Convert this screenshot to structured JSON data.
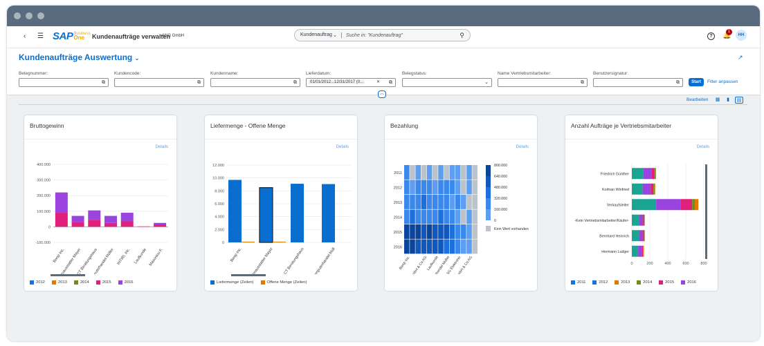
{
  "shell": {
    "app_title": "Kundenaufträge verwalten",
    "company": "ANG GmbH",
    "search_scope": "Kundenauftrag",
    "search_placeholder": "Suche in: \"Kundenauftrag\"",
    "notification_count": "1",
    "avatar_initials": "HH",
    "logo_sap": "SAP",
    "logo_business": "Business",
    "logo_one": "One"
  },
  "header": {
    "page_title": "Kundenaufträge Auswertung",
    "filters": [
      {
        "label": "Belegnummer:",
        "value": ""
      },
      {
        "label": "Kundencode:",
        "value": ""
      },
      {
        "label": "Kundenname:",
        "value": ""
      },
      {
        "label": "Lieferdatum:",
        "value": "01/01/2012...12/31/2017 (0..."
      },
      {
        "label": "Belegstatus:",
        "value": ""
      },
      {
        "label": "Name Vertriebsmitarbeiter:",
        "value": ""
      },
      {
        "label": "Benutzersignatur:",
        "value": ""
      }
    ],
    "start_label": "Start",
    "filter_adjust_label": "Filter anpassen"
  },
  "toolbar": {
    "edit_label": "Bearbeiten"
  },
  "colors": {
    "accent": "#0a6ed1",
    "y2012": "#1173e6",
    "y2013": "#e07a00",
    "y2014": "#6c8e1d",
    "y2015": "#e0207a",
    "y2016": "#9b43de",
    "y2017": "#1aa592"
  },
  "cards": {
    "gross_profit": {
      "title": "Bruttogewinn",
      "details": "Details",
      "chart_data": {
        "type": "bar",
        "stacked": true,
        "categories": [
          "Bwsp Inc.",
          "Büroausstatter Mayer",
          "CT Beratungshaus",
          "Computerhandel Müller",
          "INTIRI, Inc.",
          "Laufkunde",
          "Maxoniou F."
        ],
        "yticks": [
          "400.000",
          "300.000",
          "200.000",
          "100.000",
          "0",
          "-100.000"
        ],
        "ylim": [
          -100000,
          400000
        ],
        "series": [
          {
            "name": "2012",
            "values": [
              0,
              0,
              0,
              0,
              0,
              0,
              0
            ]
          },
          {
            "name": "2013",
            "values": [
              0,
              0,
              0,
              0,
              0,
              0,
              0
            ]
          },
          {
            "name": "2014",
            "values": [
              0,
              0,
              0,
              0,
              0,
              0,
              0
            ]
          },
          {
            "name": "2015",
            "values": [
              90000,
              30000,
              45000,
              25000,
              35000,
              2000,
              15000
            ]
          },
          {
            "name": "2016",
            "values": [
              130000,
              40000,
              60000,
              45000,
              55000,
              1000,
              10000
            ]
          }
        ],
        "legend": [
          "2012",
          "2013",
          "2014",
          "2015",
          "2016"
        ]
      }
    },
    "delivery": {
      "title": "Liefermenge - Offene Menge",
      "details": "Details",
      "chart_data": {
        "type": "bar",
        "categories": [
          "Bwsp Inc.",
          "Büroausstatter Mayer",
          "CT Beratungshaus",
          "Computerhandel Müll"
        ],
        "yticks": [
          "12.000",
          "10.000",
          "8.000",
          "6.000",
          "4.000",
          "2.000",
          "0"
        ],
        "ylim": [
          0,
          12000
        ],
        "series": [
          {
            "name": "Liefermenge (Zeilen)",
            "values": [
              9700,
              8500,
              9100,
              9050
            ]
          },
          {
            "name": "Offene Menge (Zeilen)",
            "values": [
              60,
              90,
              0,
              0
            ]
          }
        ],
        "legend": [
          "Liefermenge (Zeilen)",
          "Offene Menge (Zeilen)"
        ]
      }
    },
    "payment": {
      "title": "Bezahlung",
      "details": "Details",
      "chart_data": {
        "type": "heatmap",
        "rows": [
          "2011",
          "2012",
          "2013",
          "2014",
          "2015",
          "2016"
        ],
        "columns": [
          "Bwsp Inc.",
          "PC World GmbH & Co.KG",
          "Laufkunde",
          "Computerhandel Müller",
          "SG Elektronic",
          "Mayer GmbH & Co.KG"
        ],
        "scale": [
          "800.000",
          "640.000",
          "480.000",
          "320.000",
          "160.000",
          "0"
        ],
        "no_value_label": "Kein Wert vorhanden"
      }
    },
    "orders": {
      "title": "Anzahl Aufträge je Vertriebsmitarbeiter",
      "details": "Details",
      "chart_data": {
        "type": "bar",
        "orientation": "horizontal",
        "stacked": true,
        "categories": [
          "Friedrich Günther",
          "Kolman Winfried",
          "Verkaufsleiter",
          "-Kein Vertriebsmitarbeiter/Käufer-",
          "Bernhard Heinrich",
          "Hermann Ludger"
        ],
        "xticks": [
          "0",
          "200",
          "400",
          "600",
          "800"
        ],
        "xlim": [
          0,
          800
        ],
        "series": [
          {
            "name": "2011",
            "values": [
              0,
              0,
              0,
              0,
              0,
              0
            ]
          },
          {
            "name": "2012",
            "values": [
              0,
              0,
              0,
              0,
              0,
              0
            ]
          },
          {
            "name": "2013",
            "values": [
              10,
              10,
              40,
              5,
              5,
              5
            ]
          },
          {
            "name": "2014",
            "values": [
              10,
              10,
              30,
              5,
              5,
              5
            ]
          },
          {
            "name": "2015",
            "values": [
              30,
              30,
              130,
              15,
              15,
              15
            ]
          },
          {
            "name": "2016",
            "values": [
              90,
              90,
              270,
              40,
              40,
              40
            ]
          },
          {
            "name": "2017",
            "values": [
              130,
              120,
              270,
              80,
              80,
              70
            ]
          }
        ],
        "legend": [
          "2011",
          "2012",
          "2013",
          "2014",
          "2015",
          "2016"
        ]
      }
    }
  }
}
